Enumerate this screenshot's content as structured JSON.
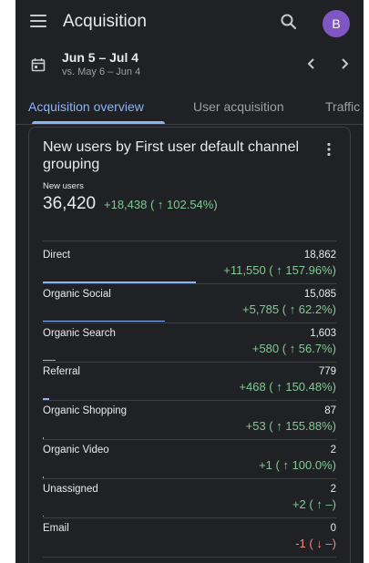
{
  "header": {
    "title": "Acquisition",
    "avatar_initial": "B",
    "avatar_color": "#7e57c2"
  },
  "date_range": {
    "primary": "Jun 5 – Jul 4",
    "comparison": "vs. May 6 – Jun 4"
  },
  "tabs": [
    {
      "label": "Acquisition overview",
      "active": true
    },
    {
      "label": "User acquisition",
      "active": false
    },
    {
      "label": "Traffic",
      "active": false
    }
  ],
  "card": {
    "title": "New users by First user default channel grouping",
    "metric_label": "New users",
    "metric_value": "36,420",
    "metric_change": "+18,438 ( ↑ 102.54%)",
    "rows": [
      {
        "name": "Direct",
        "value": "18,862",
        "change": "+11,550 ( ↑ 157.96%)",
        "trend": "up",
        "share": 0.518
      },
      {
        "name": "Organic Social",
        "value": "15,085",
        "change": "+5,785 ( ↑ 62.2%)",
        "trend": "up",
        "share": 0.414
      },
      {
        "name": "Organic Search",
        "value": "1,603",
        "change": "+580 ( ↑ 56.7%)",
        "trend": "up",
        "share": 0.044
      },
      {
        "name": "Referral",
        "value": "779",
        "change": "+468 ( ↑ 150.48%)",
        "trend": "up",
        "share": 0.021
      },
      {
        "name": "Organic Shopping",
        "value": "87",
        "change": "+53 ( ↑ 155.88%)",
        "trend": "up",
        "share": 0.0024
      },
      {
        "name": "Organic Video",
        "value": "2",
        "change": "+1 ( ↑ 100.0%)",
        "trend": "up",
        "share": 0.0001
      },
      {
        "name": "Unassigned",
        "value": "2",
        "change": "+2 ( ↑ –)",
        "trend": "up",
        "share": 0.0001
      },
      {
        "name": "Email",
        "value": "0",
        "change": "-1 ( ↓ –)",
        "trend": "down",
        "share": 0.0
      }
    ]
  },
  "colors": {
    "background": "#202124",
    "positive": "#81c995",
    "negative": "#f28b82",
    "accent": "#8ab4f8"
  },
  "icons": {
    "menu": "hamburger-menu-icon",
    "search": "magnifier-search-icon",
    "calendar": "calendar-icon",
    "prev": "chevron-left-icon",
    "next": "chevron-right-icon",
    "more": "more-vertical-icon"
  }
}
